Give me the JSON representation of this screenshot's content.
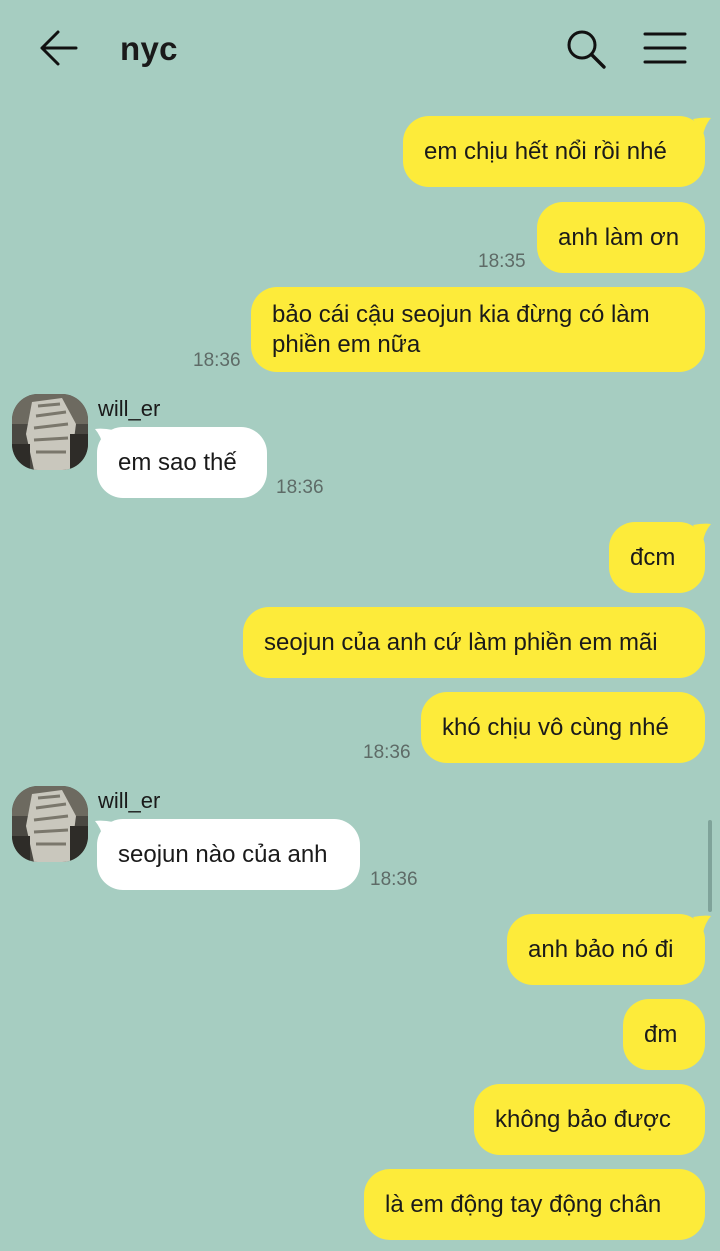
{
  "header": {
    "title": "nyc",
    "back_icon": "arrow-left-icon",
    "search_icon": "search-icon",
    "menu_icon": "hamburger-menu-icon"
  },
  "colors": {
    "background": "#a6cdc1",
    "outgoing_bubble": "#fdeb3a",
    "incoming_bubble": "#ffffff"
  },
  "messages": [
    {
      "direction": "out",
      "text": "em chịu hết nổi rồi nhé"
    },
    {
      "direction": "out",
      "text": "anh làm ơn",
      "time": "18:35"
    },
    {
      "direction": "out",
      "text": "bảo cái cậu seojun kia đừng có làm phiền em nữa",
      "time": "18:36"
    },
    {
      "direction": "in",
      "sender": "will_er",
      "text": "em sao thế",
      "time": "18:36"
    },
    {
      "direction": "out",
      "text": "đcm"
    },
    {
      "direction": "out",
      "text": "seojun của anh cứ làm phiền em mãi"
    },
    {
      "direction": "out",
      "text": "khó chịu vô cùng nhé",
      "time": "18:36"
    },
    {
      "direction": "in",
      "sender": "will_er",
      "text": "seojun nào của anh",
      "time": "18:36"
    },
    {
      "direction": "out",
      "text": "anh bảo nó đi"
    },
    {
      "direction": "out",
      "text": "đm"
    },
    {
      "direction": "out",
      "text": "không bảo được"
    },
    {
      "direction": "out",
      "text": "là em động tay động chân"
    }
  ]
}
